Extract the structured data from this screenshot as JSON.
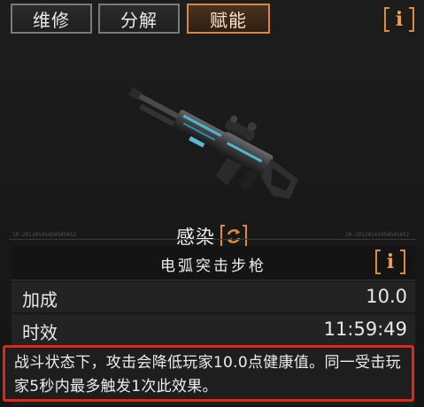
{
  "tabs": [
    {
      "label": "维修",
      "active": false
    },
    {
      "label": "分解",
      "active": false
    },
    {
      "label": "赋能",
      "active": true
    }
  ],
  "info_glyph": "i",
  "weapon": {
    "image_icon": "assault-rifle-icon",
    "effect_name": "感染",
    "refresh_icon": "refresh-icon",
    "code_left": "10-20124541454545452",
    "code_right": "10-20124541454545452"
  },
  "panel": {
    "weapon_name": "电弧突击步枪",
    "stats": [
      {
        "label": "加成",
        "value": "10.0"
      },
      {
        "label": "时效",
        "value": "11:59:49"
      }
    ],
    "description": "战斗状态下，攻击会降低玩家10.0点健康值。同一受击玩家5秒内最多触发1次此效果。"
  },
  "colors": {
    "accent_orange": "#e08b3a",
    "highlight_red": "#e1261c",
    "active_tab_bg": "#3c2818"
  }
}
